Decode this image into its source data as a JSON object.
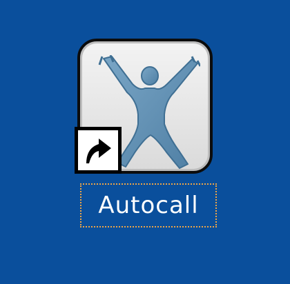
{
  "desktop": {
    "background_color": "#0a4f9c",
    "shortcut": {
      "label": "Autocall",
      "icon": "human-figure-icon",
      "overlay_icon": "shortcut-arrow-icon",
      "selected": true,
      "focus_outline_color": "#f0a646",
      "figure_color": "#5f8fb3"
    }
  }
}
